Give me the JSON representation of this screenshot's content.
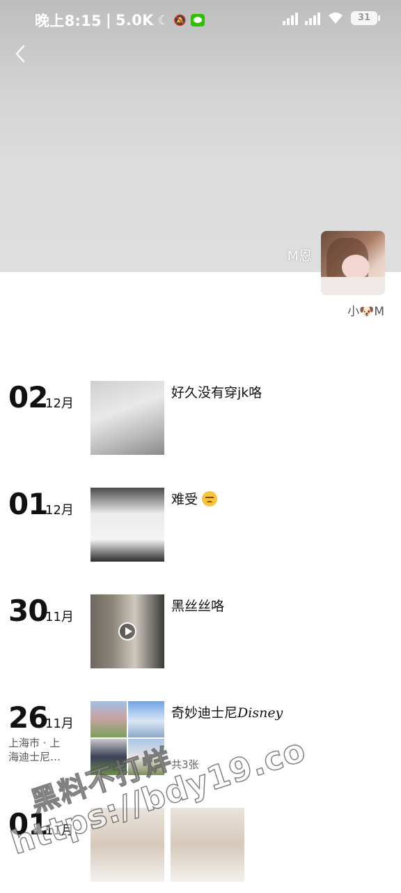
{
  "status_bar": {
    "time": "晚上8:15",
    "net_speed": "5.0K",
    "battery": "31"
  },
  "profile": {
    "name": "M恩",
    "signature": "小🐶M"
  },
  "posts": [
    {
      "day": "02",
      "month": "12月",
      "text": "好久没有穿jk咯"
    },
    {
      "day": "01",
      "month": "12月",
      "text": "难受"
    },
    {
      "day": "30",
      "month": "11月",
      "text": "黑丝丝咯"
    },
    {
      "day": "26",
      "month": "11月",
      "text_cn": "奇妙迪士尼",
      "text_en": "Disney",
      "location_line1": "上海市 · 上",
      "location_line2": "海迪士尼…",
      "count": "共3张"
    },
    {
      "day": "01",
      "month": "11月"
    }
  ],
  "watermark": {
    "line1": "黑料不打烊",
    "line2": "https://bdy19.co"
  },
  "colors": {
    "cover_gray": "#d4d4d4",
    "wechat_green": "#2dc100"
  },
  "icons": [
    "back-arrow-icon",
    "moon-icon",
    "mute-icon",
    "wechat-icon",
    "signal-icon",
    "wifi-icon",
    "battery-icon",
    "play-icon",
    "persevering-face-emoji"
  ]
}
